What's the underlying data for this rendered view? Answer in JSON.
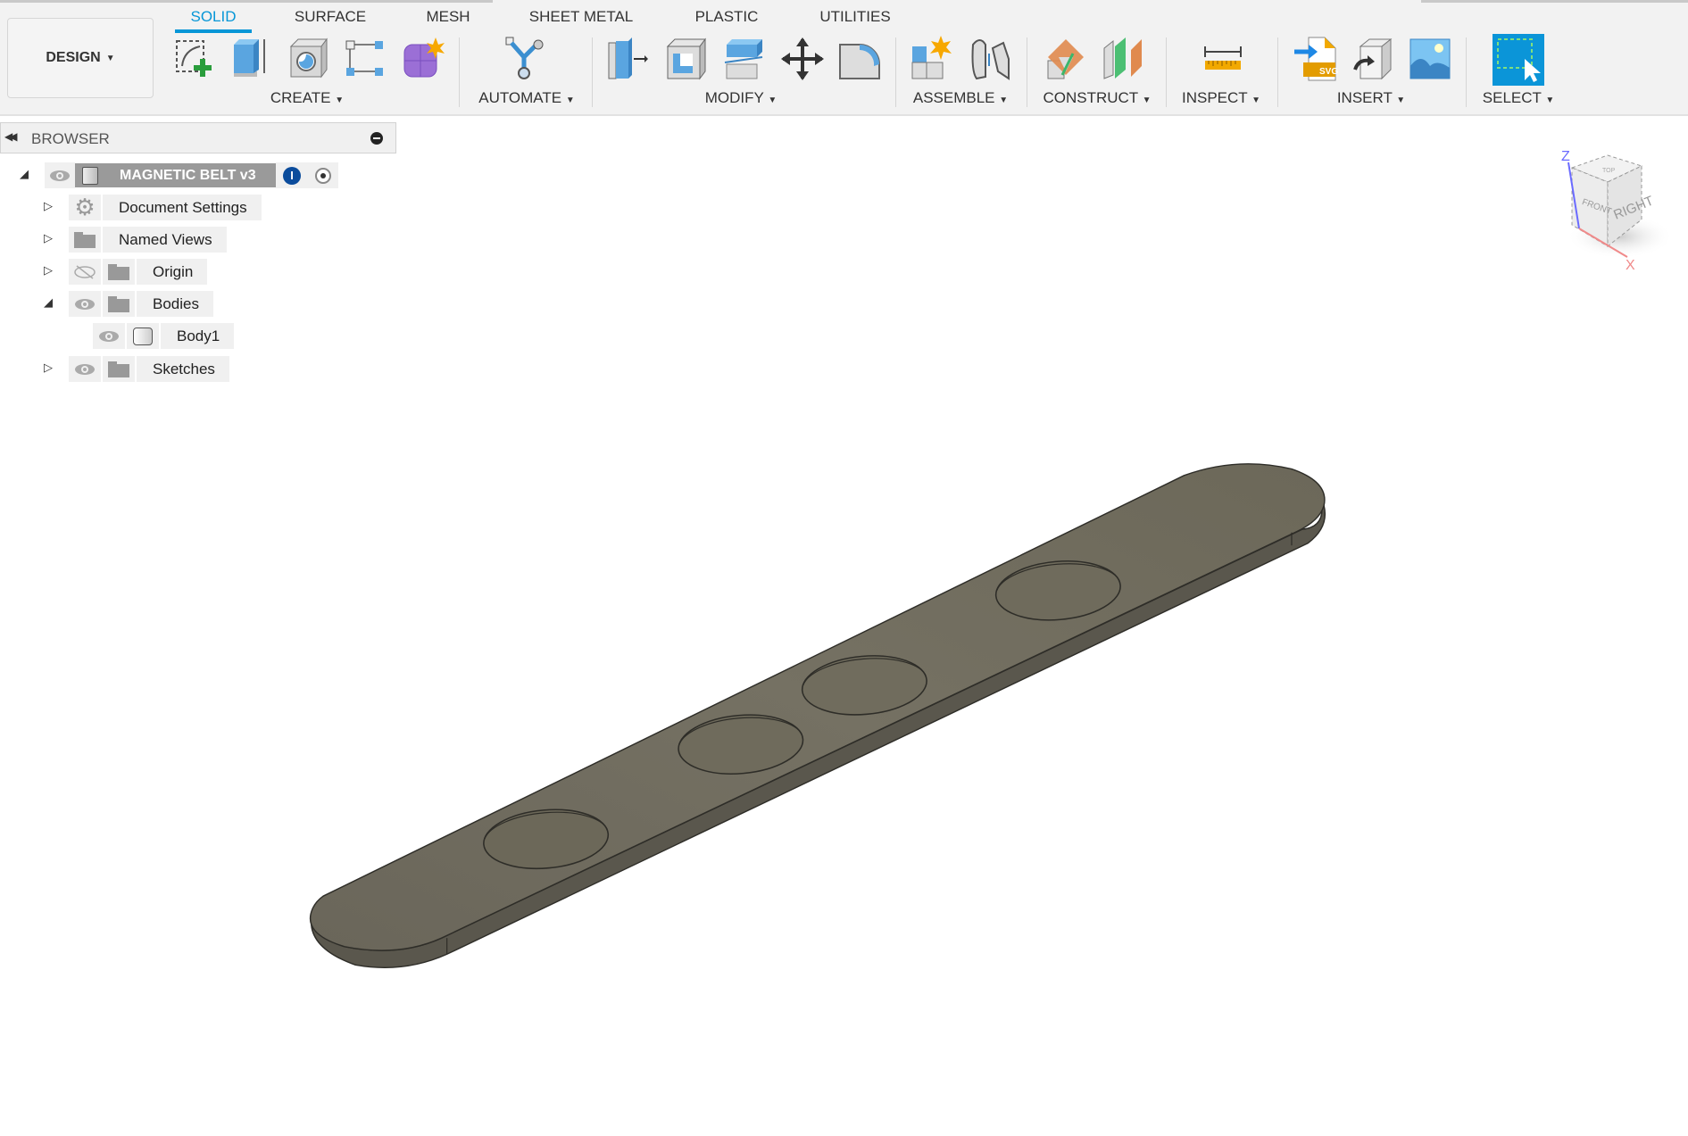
{
  "workspace": {
    "label": "DESIGN"
  },
  "tabs": [
    {
      "label": "SOLID",
      "active": true
    },
    {
      "label": "SURFACE"
    },
    {
      "label": "MESH"
    },
    {
      "label": "SHEET METAL"
    },
    {
      "label": "PLASTIC"
    },
    {
      "label": "UTILITIES"
    }
  ],
  "groups": [
    {
      "label": "CREATE"
    },
    {
      "label": "AUTOMATE"
    },
    {
      "label": "MODIFY"
    },
    {
      "label": "ASSEMBLE"
    },
    {
      "label": "CONSTRUCT"
    },
    {
      "label": "INSPECT"
    },
    {
      "label": "INSERT"
    },
    {
      "label": "SELECT"
    }
  ],
  "browser": {
    "title": "BROWSER",
    "root": "MAGNETIC BELT v3",
    "items": [
      {
        "label": "Document Settings"
      },
      {
        "label": "Named Views"
      },
      {
        "label": "Origin"
      },
      {
        "label": "Bodies"
      },
      {
        "label": "Body1"
      },
      {
        "label": "Sketches"
      }
    ]
  },
  "viewcube": {
    "faces": [
      "FRONT",
      "RIGHT",
      "TOP"
    ],
    "axes": [
      "Z",
      "X"
    ]
  },
  "colors": {
    "accent": "#0696d7",
    "body": "#6f6b5e"
  }
}
